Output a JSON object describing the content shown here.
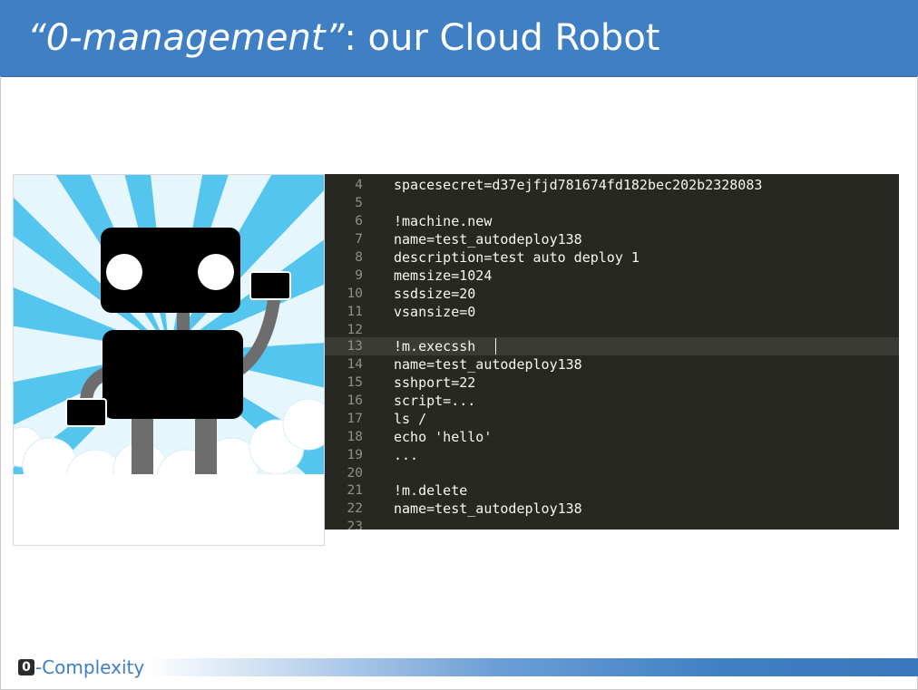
{
  "slide": {
    "title_quote_open": "“",
    "title_emphasis": "0-management",
    "title_quote_close": "”",
    "title_rest": ": our Cloud Robot"
  },
  "code_editor": {
    "active_line": "13",
    "lines": [
      {
        "num": "4",
        "text": "spacesecret=d37ejfjd781674fd182bec202b2328083"
      },
      {
        "num": "5",
        "text": ""
      },
      {
        "num": "6",
        "text": "!machine.new"
      },
      {
        "num": "7",
        "text": "name=test_autodeploy138"
      },
      {
        "num": "8",
        "text": "description=test auto deploy 1"
      },
      {
        "num": "9",
        "text": "memsize=1024"
      },
      {
        "num": "10",
        "text": "ssdsize=20"
      },
      {
        "num": "11",
        "text": "vsansize=0"
      },
      {
        "num": "12",
        "text": ""
      },
      {
        "num": "13",
        "text": "!m.execssh"
      },
      {
        "num": "14",
        "text": "name=test_autodeploy138"
      },
      {
        "num": "15",
        "text": "sshport=22"
      },
      {
        "num": "16",
        "text": "script=..."
      },
      {
        "num": "17",
        "text": "ls /"
      },
      {
        "num": "18",
        "text": "echo 'hello'"
      },
      {
        "num": "19",
        "text": "..."
      },
      {
        "num": "20",
        "text": ""
      },
      {
        "num": "21",
        "text": "!m.delete"
      },
      {
        "num": "22",
        "text": "name=test_autodeploy138"
      },
      {
        "num": "23",
        "text": ""
      }
    ]
  },
  "footer": {
    "logo_zero": "0",
    "logo_text": "-Complexity"
  },
  "colors": {
    "title_bar": "#3f7fc4",
    "editor_bg": "#272822",
    "sky_light": "#e6f6fd",
    "sky_ray": "#4cc3ef",
    "robot_body": "#000000",
    "robot_limbs": "#6d6d6d"
  },
  "icons": {
    "illustration": "cloud-robot-illustration"
  }
}
